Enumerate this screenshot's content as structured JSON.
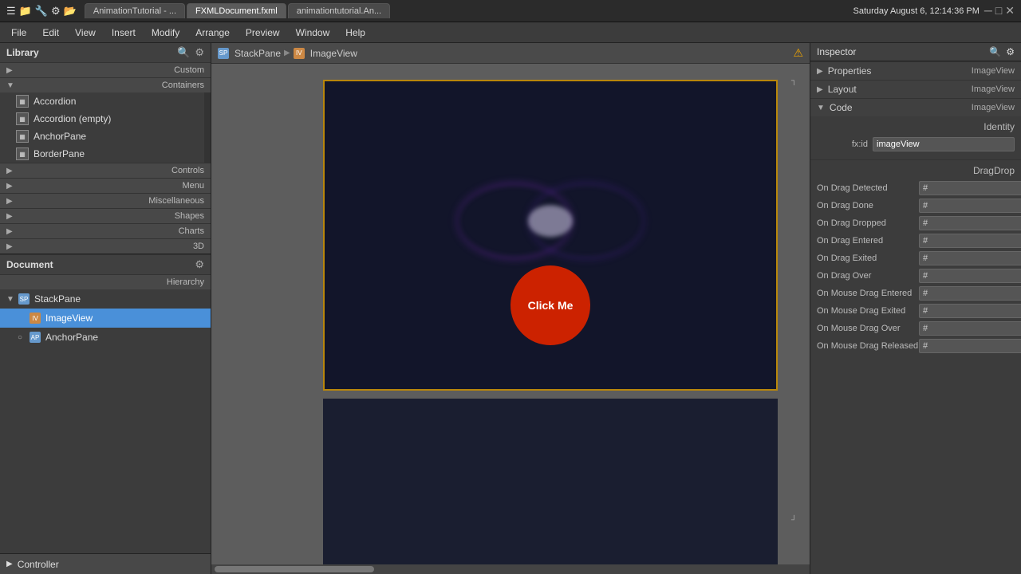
{
  "titlebar": {
    "title": "FXMLDocument.fxml",
    "tabs": [
      {
        "label": "AnimationTutorial - ...",
        "active": false
      },
      {
        "label": "FXMLDocument.fxml",
        "active": true
      },
      {
        "label": "animationtutorial.An...",
        "active": false
      }
    ],
    "app_icon": "🖥",
    "datetime": "Saturday August 6, 12:14:36 PM",
    "win_min": "─",
    "win_max": "□",
    "win_close": "✕"
  },
  "menubar": {
    "items": [
      "File",
      "Edit",
      "View",
      "Insert",
      "Modify",
      "Arrange",
      "Preview",
      "Window",
      "Help"
    ]
  },
  "library": {
    "title": "Library",
    "search_placeholder": "Search",
    "sections": [
      {
        "label": "Custom",
        "expanded": false,
        "items": []
      },
      {
        "label": "Containers",
        "expanded": true,
        "items": [
          "Accordion",
          "Accordion (empty)",
          "AnchorPane",
          "BorderPane"
        ]
      },
      {
        "label": "Controls",
        "expanded": false,
        "items": []
      },
      {
        "label": "Menu",
        "expanded": false,
        "items": []
      },
      {
        "label": "Miscellaneous",
        "expanded": false,
        "items": []
      },
      {
        "label": "Shapes",
        "expanded": false,
        "items": []
      },
      {
        "label": "Charts",
        "expanded": false,
        "items": []
      },
      {
        "label": "3D",
        "expanded": false,
        "items": []
      }
    ]
  },
  "document": {
    "title": "Document",
    "hierarchy_label": "Hierarchy",
    "tree": [
      {
        "label": "StackPane",
        "type": "stackpane",
        "indent": 0,
        "expand": true,
        "selected": false
      },
      {
        "label": "ImageView",
        "type": "imageview",
        "indent": 1,
        "expand": false,
        "selected": true
      },
      {
        "label": "AnchorPane",
        "type": "anchorpane",
        "indent": 1,
        "expand": false,
        "selected": false
      }
    ]
  },
  "controller_bar": {
    "label": "Controller"
  },
  "breadcrumb": {
    "items": [
      "StackPane",
      "ImageView"
    ],
    "warning": "⚠"
  },
  "canvas": {
    "scene_btn_label": "Click Me"
  },
  "inspector": {
    "title": "Inspector",
    "sections": [
      {
        "label": "Properties",
        "context": "ImageView"
      },
      {
        "label": "Layout",
        "context": "ImageView"
      },
      {
        "label": "Code",
        "context": "ImageView"
      }
    ],
    "identity": {
      "title": "Identity",
      "fx_id_label": "fx:id",
      "fx_id_value": "imageView"
    },
    "dragdrop": {
      "title": "DragDrop",
      "events": [
        {
          "label": "On Drag Detected",
          "value": "#"
        },
        {
          "label": "On Drag Done",
          "value": "#"
        },
        {
          "label": "On Drag Dropped",
          "value": "#"
        },
        {
          "label": "On Drag Entered",
          "value": "#"
        },
        {
          "label": "On Drag Exited",
          "value": "#"
        },
        {
          "label": "On Drag Over",
          "value": "#"
        },
        {
          "label": "On Mouse Drag Entered",
          "value": "#"
        },
        {
          "label": "On Mouse Drag Exited",
          "value": "#"
        },
        {
          "label": "On Mouse Drag Over",
          "value": "#"
        },
        {
          "label": "On Mouse Drag Released",
          "value": "#"
        }
      ]
    }
  }
}
